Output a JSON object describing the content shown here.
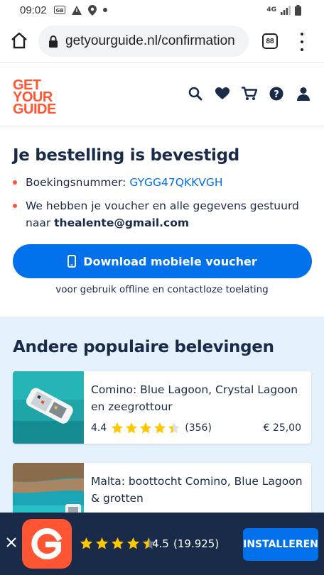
{
  "status_bar": {
    "time": "09:02",
    "network": "4G"
  },
  "browser": {
    "url": "getyourguide.nl/confirmation",
    "tab_count": "88"
  },
  "site": {
    "logo_lines": [
      "GET",
      "YOUR",
      "GUIDE"
    ]
  },
  "confirmation": {
    "heading": "Je bestelling is bevestigd",
    "booking_label": "Boekingsnummer:",
    "booking_code": "GYGG47QKKVGH",
    "voucher_text": "We hebben je voucher en alle gegevens gestuurd naar",
    "email": "thealente@gmail.com",
    "download_button": "Download mobiele voucher",
    "download_note": "voor gebruik offline en contactloze toelating"
  },
  "popular": {
    "heading": "Andere populaire belevingen",
    "cards": [
      {
        "title": "Comino: Blue Lagoon, Crystal Lagoon en zeegrottour",
        "rating": "4.4",
        "stars": 4.4,
        "reviews": "(356)",
        "price": "€ 25,00"
      },
      {
        "title": "Malta: boottocht Comino, Blue Lagoon & grotten"
      }
    ]
  },
  "app_banner": {
    "rating": "4.5",
    "stars": 4.5,
    "count": "(19.925)",
    "install_label": "INSTALLEREN"
  },
  "colors": {
    "brand_orange": "#ff5533",
    "primary_blue": "#0071eb",
    "navy": "#1a2b49",
    "star_yellow": "#ffc700",
    "section_bg": "#e5f1fd"
  }
}
